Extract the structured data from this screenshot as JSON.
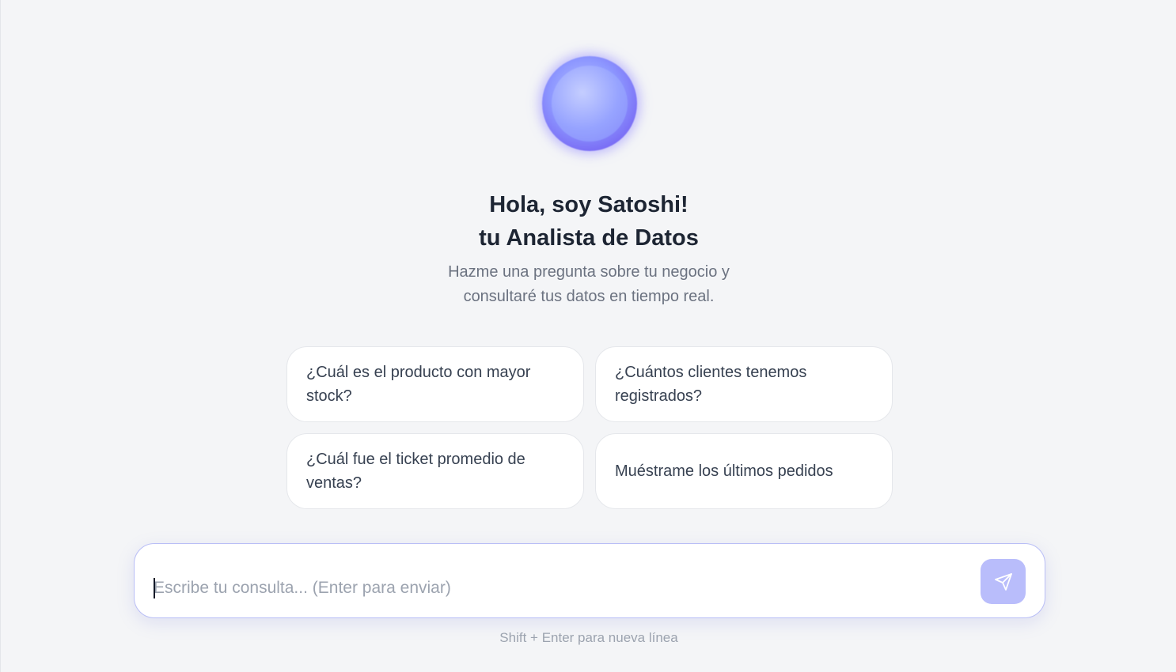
{
  "hero": {
    "avatar_icon": "gradient-orb-icon",
    "title_line1": "Hola, soy Satoshi!",
    "title_line2": "tu Analista de Datos",
    "subtitle_line1": "Hazme una pregunta sobre tu negocio y",
    "subtitle_line2": "consultaré tus datos en tiempo real."
  },
  "suggestions": [
    {
      "label": "¿Cuál es el producto con mayor stock?"
    },
    {
      "label": "¿Cuántos clientes tenemos registrados?"
    },
    {
      "label": "¿Cuál fue el ticket promedio de ventas?"
    },
    {
      "label": "Muéstrame los últimos pedidos"
    }
  ],
  "composer": {
    "value": "",
    "placeholder": "Escribe tu consulta... (Enter para enviar)",
    "send_icon": "send-icon",
    "hint": "Shift + Enter para nueva línea"
  },
  "colors": {
    "background": "#f4f5f7",
    "accent": "#b9bdfb",
    "title": "#1d2533",
    "muted": "#6b7280"
  }
}
